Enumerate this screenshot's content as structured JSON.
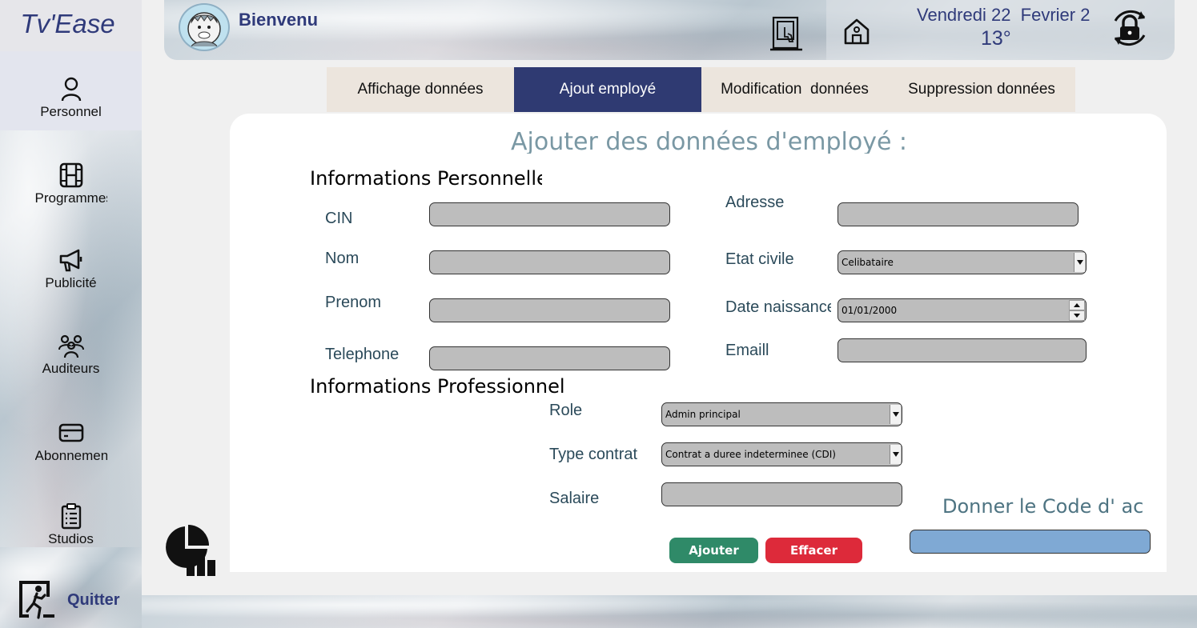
{
  "app": {
    "logo": "Tv'Ease"
  },
  "sidebar": {
    "items": [
      {
        "label": "Personnel",
        "icon": "person-icon",
        "active": true
      },
      {
        "label": "Programmes",
        "icon": "film-icon"
      },
      {
        "label": "Publicité",
        "icon": "megaphone-icon"
      },
      {
        "label": "Auditeurs",
        "icon": "users-icon"
      },
      {
        "label": "Abonnements",
        "icon": "card-icon"
      },
      {
        "label": "Studios",
        "icon": "clipboard-icon"
      }
    ],
    "quit_label": "Quitter"
  },
  "header": {
    "welcome": "Bienvenu",
    "date": "Vendredi 22  Fevrier 2",
    "temperature": "13°"
  },
  "tabs": [
    {
      "label": "Affichage données"
    },
    {
      "label": "Ajout employé",
      "active": true
    },
    {
      "label": "Modification  données"
    },
    {
      "label": "Suppression données"
    }
  ],
  "form": {
    "title": "Ajouter des données d'employé :",
    "personal_section": "Informations Personnelles",
    "pro_section": "Informations Professionnel",
    "labels": {
      "cin": "CIN",
      "nom": "Nom",
      "prenom": "Prenom",
      "telephone": "Telephone",
      "adresse": "Adresse",
      "etat_civile": "Etat civile",
      "date_naissance": "Date naissance",
      "email": "Emaill",
      "role": "Role",
      "type_contrat": "Type contrat",
      "salaire": "Salaire"
    },
    "values": {
      "etat_civile": "Celibataire",
      "date_naissance": "01/01/2000",
      "role": "Admin principal",
      "type_contrat": "Contrat a duree indeterminee (CDI)"
    },
    "code_label": "Donner le Code d' acces",
    "buttons": {
      "add": "Ajouter",
      "clear": "Effacer"
    }
  },
  "colors": {
    "accent": "#2f3a72",
    "label": "#2b4a5a",
    "add_button": "#2f8a68",
    "clear_button": "#dd2a3a",
    "code_input": "#7fa9d4"
  }
}
